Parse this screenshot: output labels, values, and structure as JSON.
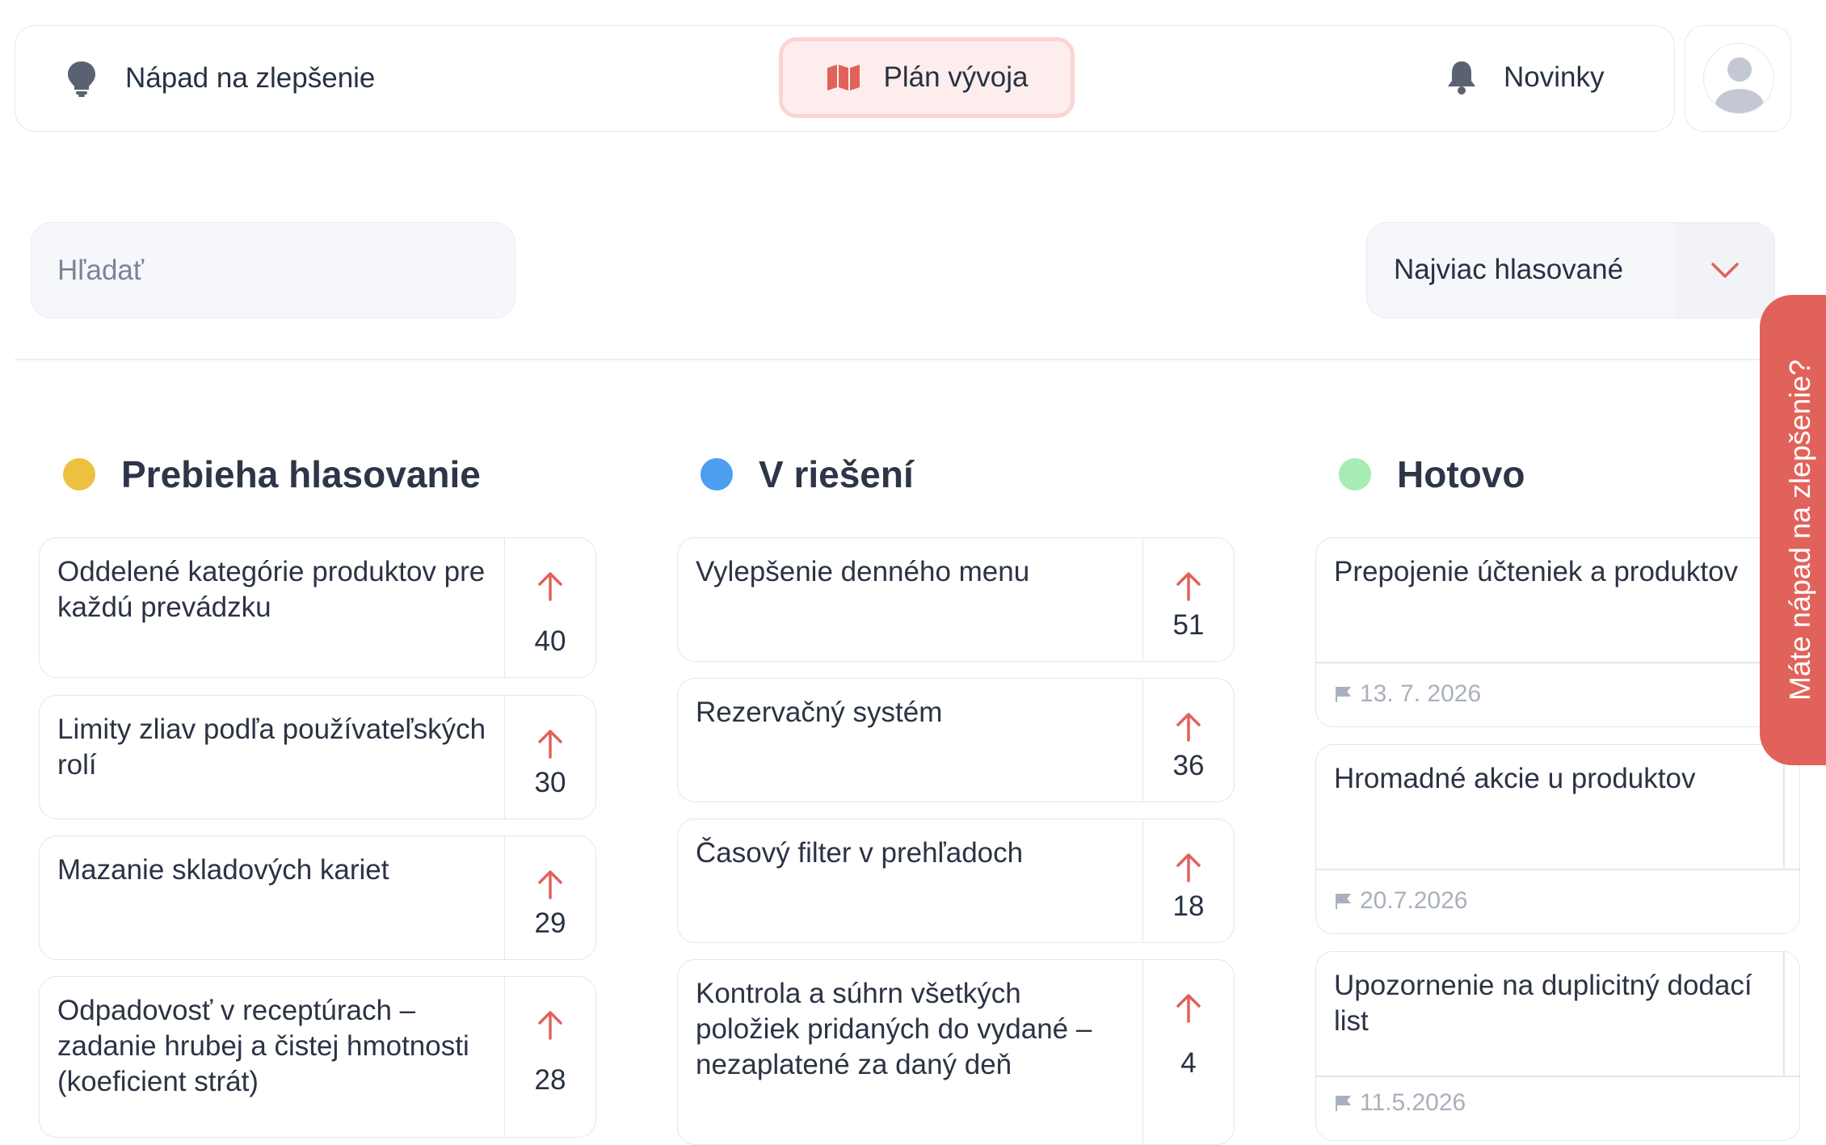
{
  "nav": {
    "ideas": {
      "label": "Nápad na zlepšenie",
      "icon": "lightbulb-icon"
    },
    "plan": {
      "label": "Plán vývoja",
      "icon": "map-icon",
      "active": true
    },
    "news": {
      "label": "Novinky",
      "icon": "bell-icon"
    },
    "profile": {
      "icon": "user-avatar-icon"
    }
  },
  "filters": {
    "search_placeholder": "Hľadať",
    "sort_label": "Najviac hlasované",
    "sort_icon": "chevron-down-icon"
  },
  "columns": [
    {
      "title": "Prebieha hlasovanie",
      "color": "#ecc140",
      "cards": [
        {
          "title": "Oddelené kategórie produktov pre každú prevádzku",
          "votes": "40"
        },
        {
          "title": "Limity zliav podľa používateľských rolí",
          "votes": "30"
        },
        {
          "title": "Mazanie skladových kariet",
          "votes": "29"
        },
        {
          "title": "Odpadovosť v receptúrach – zadanie hrubej a čistej hmotnosti (koeficient strát)",
          "votes": "28"
        }
      ]
    },
    {
      "title": "V riešení",
      "color": "#4b9ef0",
      "cards": [
        {
          "title": "Vylepšenie denného menu",
          "votes": "51"
        },
        {
          "title": "Rezervačný systém",
          "votes": "36"
        },
        {
          "title": "Časový filter v prehľadoch",
          "votes": "18"
        },
        {
          "title": "Kontrola a súhrn všetkých položiek pridaných do vydané – nezaplatené za daný deň",
          "votes": "4"
        }
      ]
    },
    {
      "title": "Hotovo",
      "color": "#a6ecb4",
      "cards": [
        {
          "title": "Prepojenie účteniek a produktov",
          "date": "13. 7. 2026"
        },
        {
          "title": "Hromadné akcie u produktov",
          "date": "20.7.2026"
        },
        {
          "title": "Upozornenie na duplicitný dodací list",
          "date": "11.5.2026"
        }
      ]
    }
  ],
  "feedback_tab": {
    "label": "Máte nápad na zlepšenie?"
  },
  "colors": {
    "accent": "#e1625a",
    "accent_soft": "#fdeeed",
    "text": "#2b3344"
  }
}
